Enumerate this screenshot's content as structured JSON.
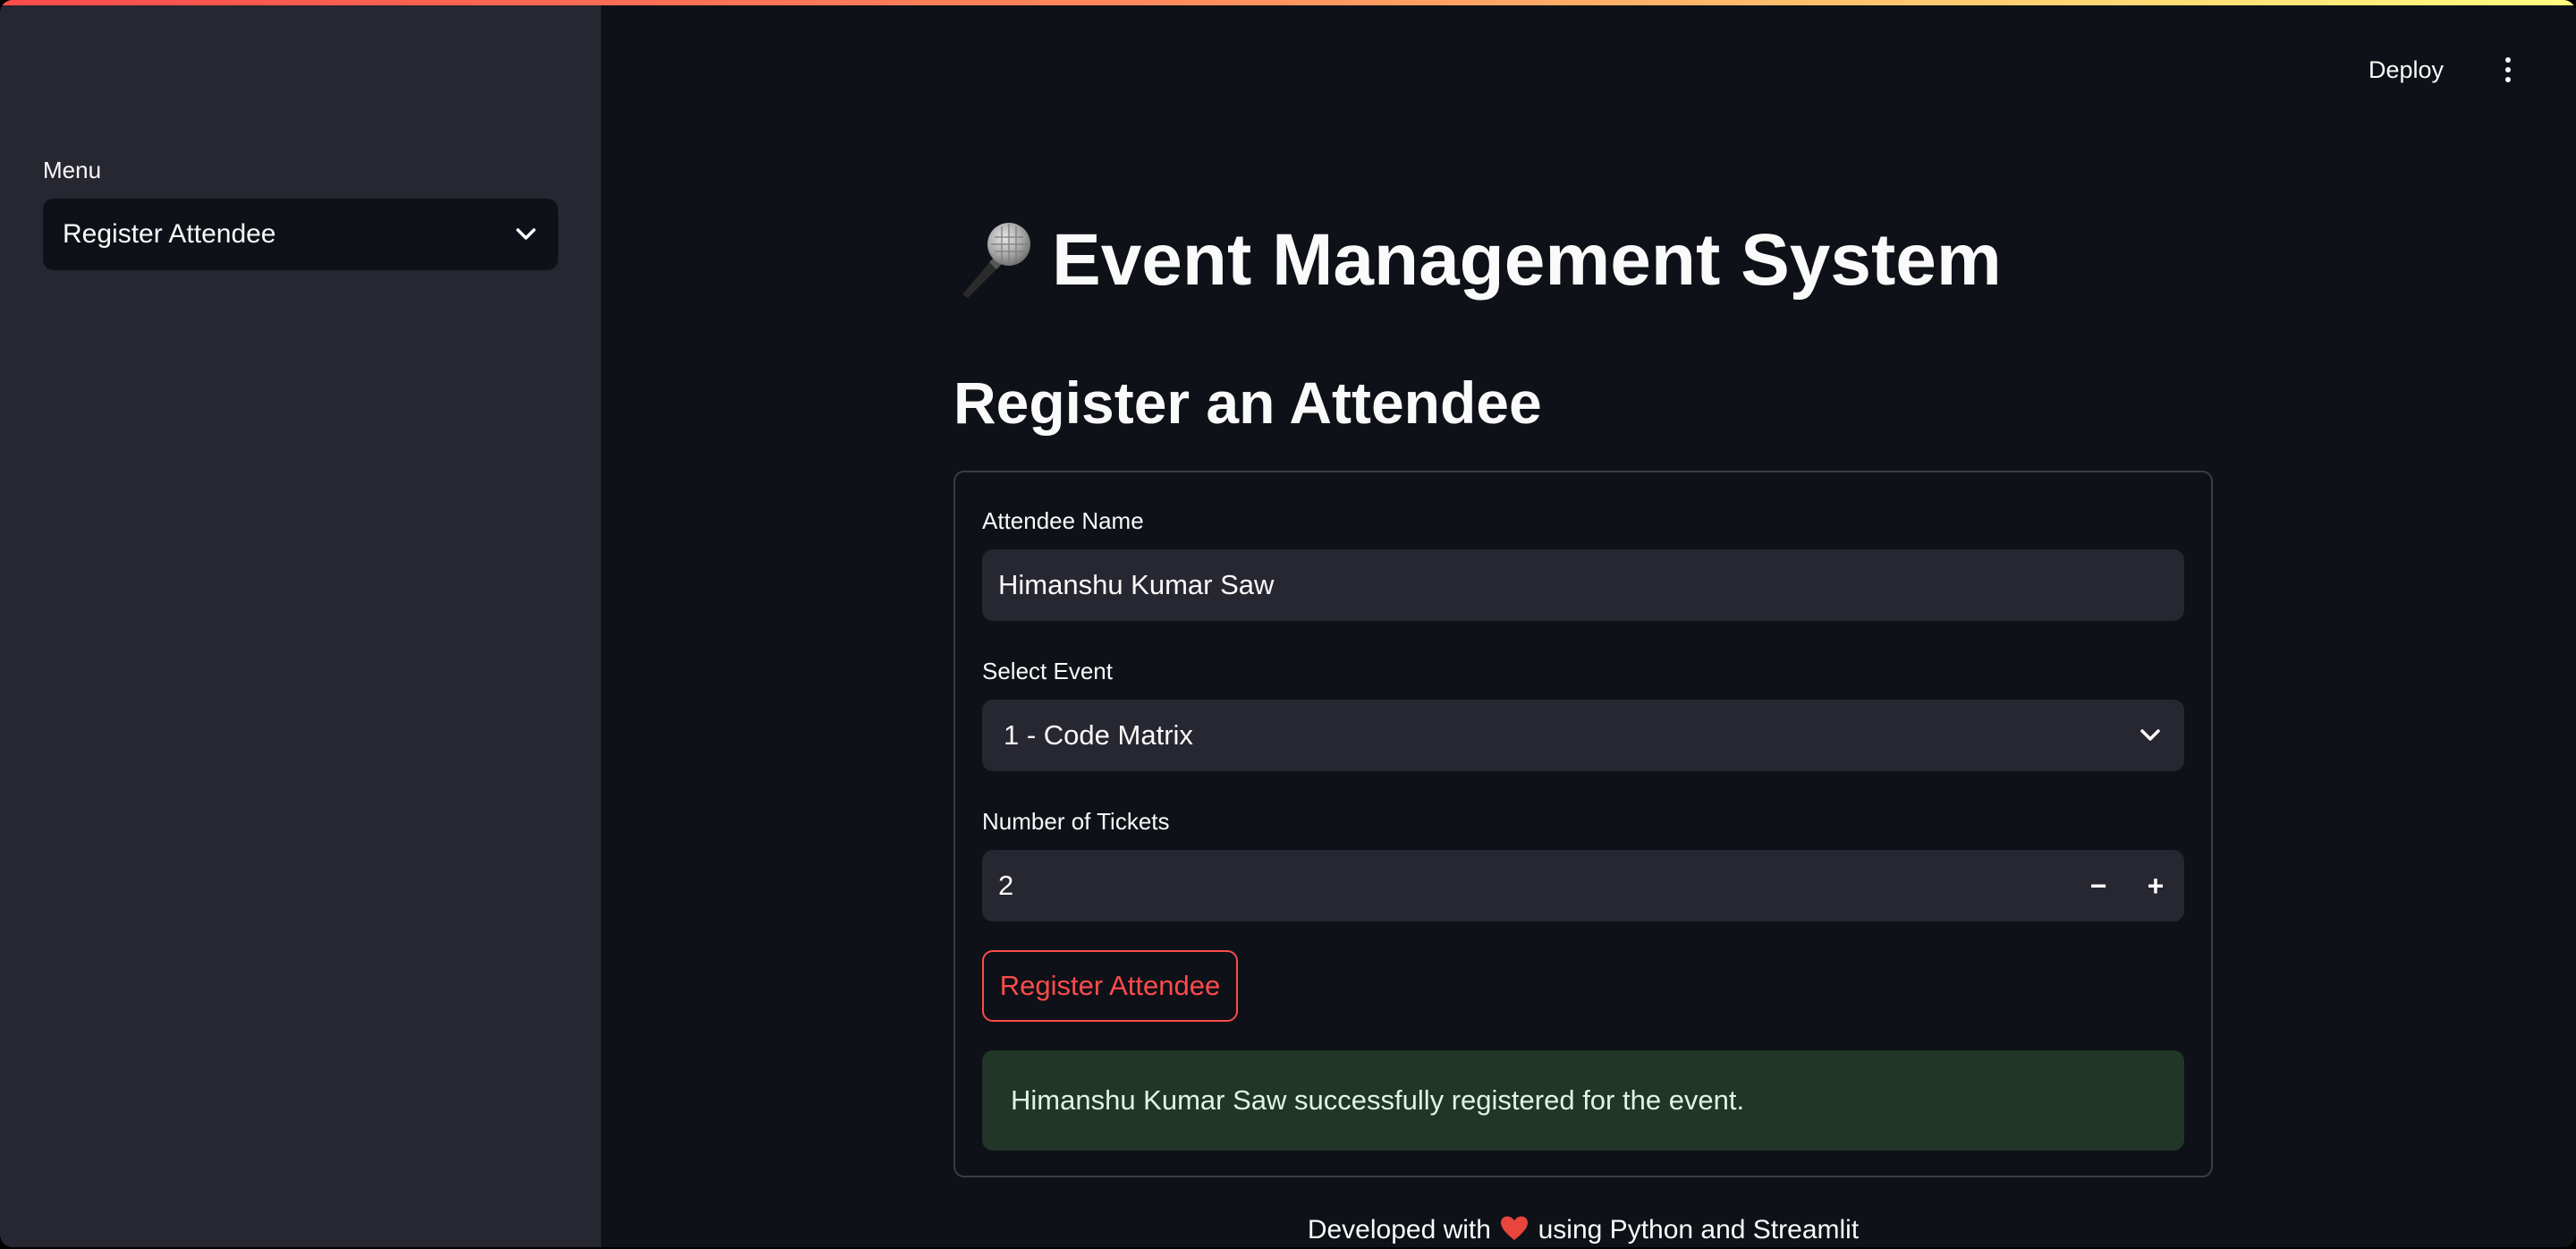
{
  "header": {
    "deploy_label": "Deploy"
  },
  "sidebar": {
    "menu_label": "Menu",
    "menu_selected": "Register Attendee"
  },
  "main": {
    "title": "Event Management System",
    "title_icon": "microphone-icon",
    "subheader": "Register an Attendee"
  },
  "form": {
    "name_label": "Attendee Name",
    "name_value": "Himanshu Kumar Saw",
    "event_label": "Select Event",
    "event_selected": "1 - Code Matrix",
    "tickets_label": "Number of Tickets",
    "tickets_value": "2",
    "minus_label": "−",
    "plus_label": "+",
    "submit_label": "Register Attendee",
    "success_message": "Himanshu Kumar Saw successfully registered for the event."
  },
  "footer": {
    "text_before": "Developed with",
    "text_after": "using Python and Streamlit",
    "icon": "heart-icon"
  },
  "colors": {
    "background": "#0e1117",
    "sidebar": "#262730",
    "accent": "#ff4b4b",
    "success_bg": "#213528"
  }
}
